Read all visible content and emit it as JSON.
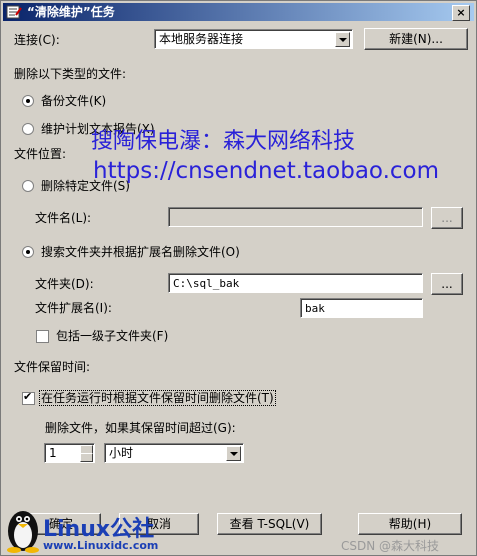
{
  "window": {
    "title": "“清除维护”任务",
    "close_label": "×"
  },
  "connection": {
    "label": "连接(C):",
    "value": "本地服务器连接",
    "new_button": "新建(N)..."
  },
  "delete_types": {
    "heading": "删除以下类型的文件:",
    "backup_files": "备份文件(K)",
    "maintenance_reports": "维护计划文本报告(X)"
  },
  "file_location": {
    "heading": "文件位置:",
    "delete_specific": "删除特定文件(S)",
    "file_name_label": "文件名(L):",
    "file_name_value": "",
    "browse_label": "...",
    "search_folder": "搜索文件夹并根据扩展名删除文件(O)",
    "folder_label": "文件夹(D):",
    "folder_value": "C:\\sql_bak",
    "folder_browse_label": "...",
    "extension_label": "文件扩展名(I):",
    "extension_value": "bak",
    "include_subfolders": "包括一级子文件夹(F)"
  },
  "retention": {
    "heading": "文件保留时间:",
    "delete_by_age": "在任务运行时根据文件保留时间删除文件(T)",
    "older_than_label": "删除文件，如果其保留时间超过(G):",
    "amount": "1",
    "unit": "小时"
  },
  "footer": {
    "ok": "确定",
    "cancel": "取消",
    "view_tsql": "查看 T-SQL(V)",
    "help": "帮助(H)"
  },
  "watermarks": {
    "shop_line1": "搜陶保电瀑：森大网络科技",
    "shop_line2": "https://cnsendnet.taobao.com",
    "linux_brand": "Linux公社",
    "linux_url": "www.Linuxidc.com",
    "csdn": "CSDN @森大科技"
  }
}
